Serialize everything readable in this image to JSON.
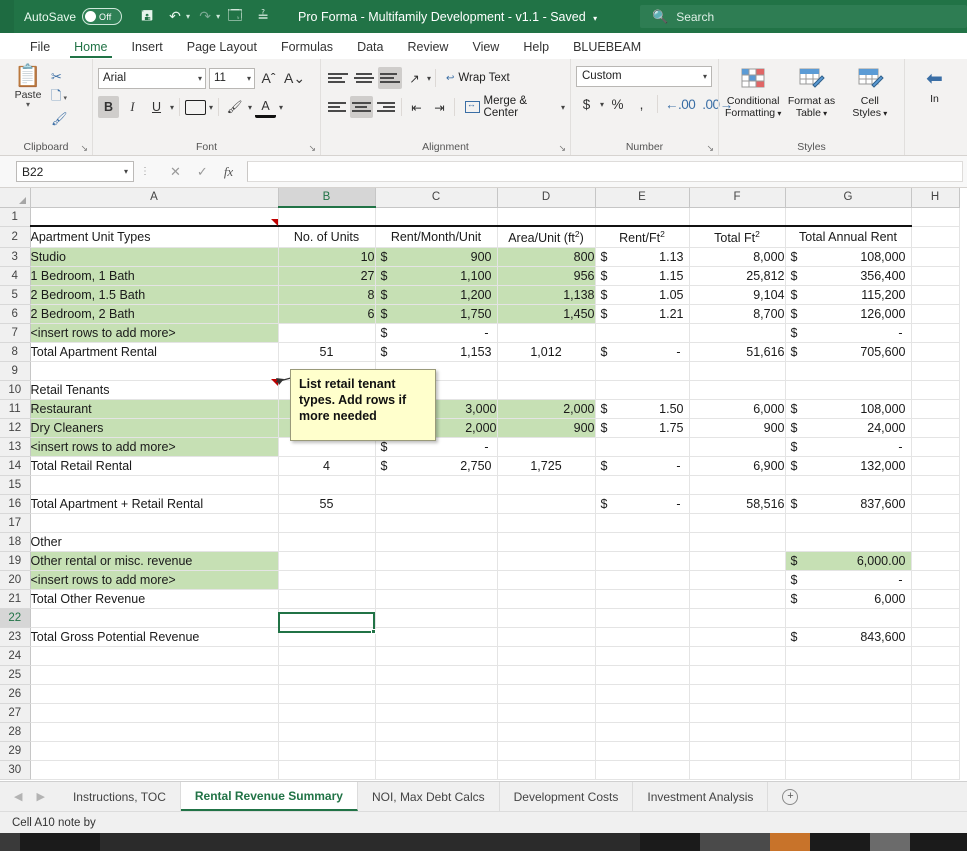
{
  "titlebar": {
    "autosave_label": "AutoSave",
    "autosave_state": "Off",
    "doc_title": "Pro Forma - Multifamily Development - v1.1 - Saved",
    "title_caret": "⌄",
    "qat": [
      {
        "name": "save-icon",
        "glyph": "὚B"
      },
      {
        "name": "undo-icon",
        "glyph": "↺"
      },
      {
        "name": "redo-icon",
        "glyph": "↻"
      },
      {
        "name": "print-preview-icon",
        "glyph": "🗐"
      },
      {
        "name": "customize-qat-icon",
        "glyph": "⌄"
      }
    ],
    "search_placeholder": "Search",
    "search_icon": "search-icon"
  },
  "ribbon_tabs": [
    {
      "label": "File",
      "active": false
    },
    {
      "label": "Home",
      "active": true
    },
    {
      "label": "Insert",
      "active": false
    },
    {
      "label": "Page Layout",
      "active": false
    },
    {
      "label": "Formulas",
      "active": false
    },
    {
      "label": "Data",
      "active": false
    },
    {
      "label": "Review",
      "active": false
    },
    {
      "label": "View",
      "active": false
    },
    {
      "label": "Help",
      "active": false
    },
    {
      "label": "BLUEBEAM",
      "active": false
    }
  ],
  "ribbon": {
    "clipboard": {
      "group": "Clipboard",
      "paste": "Paste",
      "cut_icon": "scissors-icon",
      "copy_icon": "copy-icon",
      "format_painter_icon": "format-painter-icon"
    },
    "font": {
      "group": "Font",
      "font_name": "Arial",
      "font_size": "11",
      "grow_icon": "increase-font-size-icon",
      "shrink_icon": "decrease-font-size-icon",
      "bold": "B",
      "italic": "I",
      "underline": "U",
      "borders_icon": "borders-icon",
      "fill_icon": "fill-color-icon",
      "font_color_icon": "font-color-icon"
    },
    "alignment": {
      "group": "Alignment",
      "wrap_text": "Wrap Text",
      "merge_center": "Merge & Center",
      "orientation_icon": "orientation-icon",
      "decrease_indent_icon": "decrease-indent-icon",
      "increase_indent_icon": "increase-indent-icon"
    },
    "number": {
      "group": "Number",
      "format": "Custom",
      "currency": "$",
      "percent": "%",
      "comma": "ɧ",
      "decrease_decimal_icon": "decrease-decimal-icon",
      "increase_decimal_icon": "increase-decimal-icon"
    },
    "styles": {
      "group": "Styles",
      "conditional_formatting": "Conditional\nFormatting",
      "conditional_formatting_l1": "Conditional",
      "conditional_formatting_l2": "Formatting",
      "format_as_table_l1": "Format as",
      "format_as_table_l2": "Table",
      "cell_styles_l1": "Cell",
      "cell_styles_l2": "Styles"
    },
    "cells": {
      "group": "Cells",
      "insert_l1": "In"
    }
  },
  "formula_bar": {
    "name_box": "B22",
    "cancel_icon": "cancel-icon",
    "enter_icon": "confirm-icon",
    "function_icon": "insert-function-icon",
    "value": ""
  },
  "grid": {
    "columns": [
      "A",
      "B",
      "C",
      "D",
      "E",
      "F",
      "G",
      "H"
    ],
    "selected_column": "B",
    "selected_row": 22,
    "rows": [
      {
        "n": 1,
        "cells": [
          "",
          "",
          "",
          "",
          "",
          "",
          "",
          ""
        ]
      },
      {
        "n": 2,
        "cells": [
          "Apartment Unit Types",
          "No. of Units",
          "Rent/Month/Unit",
          "Area/Unit (ft²)",
          "Rent/Ft²",
          "Total Ft²",
          "Total Annual Rent",
          ""
        ]
      },
      {
        "n": 3,
        "cells": [
          "Studio",
          "10",
          "900",
          "800",
          "1.13",
          "8,000",
          "108,000",
          ""
        ]
      },
      {
        "n": 4,
        "cells": [
          "1 Bedroom, 1 Bath",
          "27",
          "1,100",
          "956",
          "1.15",
          "25,812",
          "356,400",
          ""
        ]
      },
      {
        "n": 5,
        "cells": [
          "2 Bedroom, 1.5 Bath",
          "8",
          "1,200",
          "1,138",
          "1.05",
          "9,104",
          "115,200",
          ""
        ]
      },
      {
        "n": 6,
        "cells": [
          "2 Bedroom, 2 Bath",
          "6",
          "1,750",
          "1,450",
          "1.21",
          "8,700",
          "126,000",
          ""
        ]
      },
      {
        "n": 7,
        "cells": [
          "<insert rows to add more>",
          "",
          "-",
          "",
          "",
          "",
          "-",
          ""
        ]
      },
      {
        "n": 8,
        "cells": [
          "Total Apartment Rental",
          "51",
          "1,153",
          "1,012",
          "-",
          "51,616",
          "705,600",
          ""
        ]
      },
      {
        "n": 9,
        "cells": [
          "",
          "",
          "",
          "",
          "",
          "",
          "",
          ""
        ]
      },
      {
        "n": 10,
        "cells": [
          "Retail Tenants",
          "",
          "",
          "",
          "",
          "",
          "",
          ""
        ]
      },
      {
        "n": 11,
        "cells": [
          "Restaurant",
          "",
          "",
          "2,000",
          "1.50",
          "6,000",
          "108,000",
          ""
        ]
      },
      {
        "n": 12,
        "cells": [
          "Dry Cleaners",
          "",
          "",
          "900",
          "1.75",
          "900",
          "24,000",
          ""
        ]
      },
      {
        "n": 13,
        "cells": [
          "<insert rows to add more>",
          "",
          "-",
          "",
          "",
          "",
          "-",
          ""
        ]
      },
      {
        "n": 14,
        "cells": [
          "Total Retail Rental",
          "4",
          "2,750",
          "1,725",
          "-",
          "6,900",
          "132,000",
          ""
        ]
      },
      {
        "n": 15,
        "cells": [
          "",
          "",
          "",
          "",
          "",
          "",
          "",
          ""
        ]
      },
      {
        "n": 16,
        "cells": [
          "Total Apartment + Retail Rental",
          "55",
          "",
          "",
          "-",
          "58,516",
          "837,600",
          ""
        ]
      },
      {
        "n": 17,
        "cells": [
          "",
          "",
          "",
          "",
          "",
          "",
          "",
          ""
        ]
      },
      {
        "n": 18,
        "cells": [
          "Other",
          "",
          "",
          "",
          "",
          "",
          "",
          ""
        ]
      },
      {
        "n": 19,
        "cells": [
          "Other rental or misc. revenue",
          "",
          "",
          "",
          "",
          "",
          "6,000.00",
          ""
        ]
      },
      {
        "n": 20,
        "cells": [
          "<insert rows to add more>",
          "",
          "",
          "",
          "",
          "",
          "-",
          ""
        ]
      },
      {
        "n": 21,
        "cells": [
          "Total Other Revenue",
          "",
          "",
          "",
          "",
          "",
          "6,000",
          ""
        ]
      },
      {
        "n": 22,
        "cells": [
          "",
          "",
          "",
          "",
          "",
          "",
          "",
          ""
        ]
      },
      {
        "n": 23,
        "cells": [
          "Total Gross Potential Revenue",
          "",
          "",
          "",
          "",
          "",
          "843,600",
          ""
        ]
      },
      {
        "n": 24,
        "cells": [
          "",
          "",
          "",
          "",
          "",
          "",
          "",
          ""
        ]
      },
      {
        "n": 25,
        "cells": [
          "",
          "",
          "",
          "",
          "",
          "",
          "",
          ""
        ]
      },
      {
        "n": 26,
        "cells": [
          "",
          "",
          "",
          "",
          "",
          "",
          "",
          ""
        ]
      },
      {
        "n": 27,
        "cells": [
          "",
          "",
          "",
          "",
          "",
          "",
          "",
          ""
        ]
      },
      {
        "n": 28,
        "cells": [
          "",
          "",
          "",
          "",
          "",
          "",
          "",
          ""
        ]
      },
      {
        "n": 29,
        "cells": [
          "",
          "",
          "",
          "",
          "",
          "",
          "",
          ""
        ]
      },
      {
        "n": 30,
        "cells": [
          "",
          "",
          "",
          "",
          "",
          "",
          "",
          ""
        ]
      }
    ],
    "c11_partial": "3,000",
    "c12_partial": "2,000",
    "comment_tooltip": {
      "anchor_cell": "A10",
      "text": "List retail tenant types.  Add rows if more needed"
    },
    "comment_markers": [
      "A2",
      "A10"
    ]
  },
  "sheet_tabs": [
    {
      "label": "Instructions, TOC",
      "active": false
    },
    {
      "label": "Rental Revenue Summary",
      "active": true
    },
    {
      "label": "NOI, Max Debt Calcs",
      "active": false
    },
    {
      "label": "Development Costs",
      "active": false
    },
    {
      "label": "Investment Analysis",
      "active": false
    }
  ],
  "sheet_nav": {
    "prev_icon": "previous-sheet-icon",
    "next_icon": "next-sheet-icon",
    "add_icon": "add-sheet-icon",
    "add_glyph": "+"
  },
  "status_bar": {
    "text": "Cell A10 note by"
  },
  "colors": {
    "excel_green": "#217346",
    "cell_input_green": "#c6e0b4",
    "selection_green": "#217346",
    "comment_marker_red": "#c00000",
    "tooltip_yellow": "#ffffcc"
  }
}
